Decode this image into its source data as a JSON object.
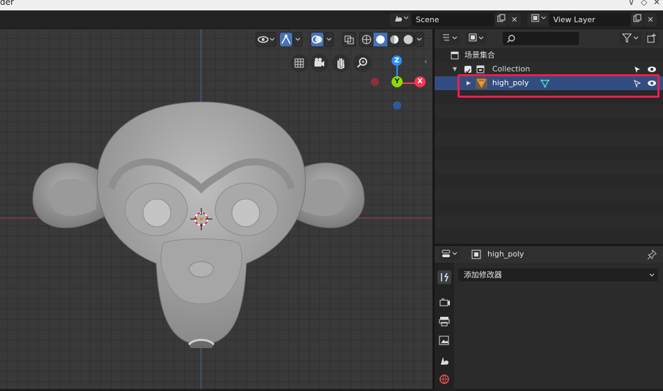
{
  "window": {
    "title_fragment": "der",
    "controls": [
      "∨",
      "◇",
      "✕"
    ]
  },
  "topbar": {
    "scene_label": "Scene",
    "view_layer_label": "View Layer"
  },
  "viewport": {
    "gizmo": {
      "z_label": "Z",
      "y_label": "Y",
      "x_label": "X"
    },
    "colors": {
      "x_axis": "#ff3352",
      "y_axis": "#8bdc00",
      "z_axis": "#2890ff"
    }
  },
  "outliner": {
    "search_placeholder": "",
    "rows": [
      {
        "label": "场景集合"
      },
      {
        "label": "Collection"
      },
      {
        "label": "high_poly"
      }
    ]
  },
  "properties": {
    "object_name": "high_poly",
    "add_modifier_label": "添加修改器"
  },
  "annotation": {
    "highlight_color": "#e8204a"
  }
}
